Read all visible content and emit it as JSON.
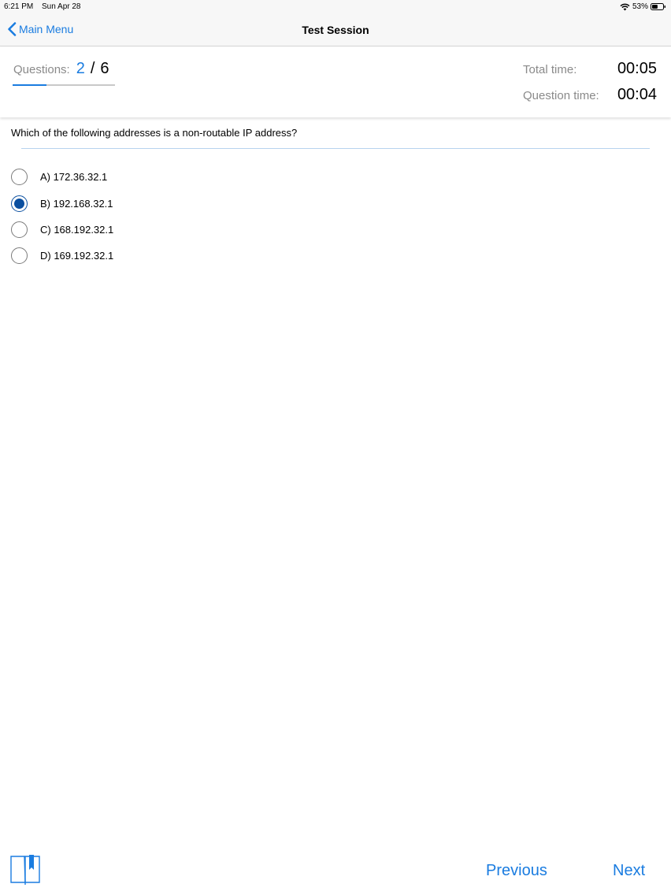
{
  "status_bar": {
    "time": "6:21 PM",
    "date": "Sun Apr 28",
    "battery": "53%",
    "battery_level": 0.53
  },
  "nav": {
    "back_label": "Main Menu",
    "title": "Test Session"
  },
  "header": {
    "questions_label": "Questions:",
    "current": "2",
    "separator": "/",
    "total": "6",
    "progress": 0.333,
    "total_time_label": "Total time:",
    "total_time": "00:05",
    "question_time_label": "Question time:",
    "question_time": "00:04"
  },
  "question": {
    "text": "Which of the following addresses is a non-routable IP address?",
    "answers": [
      {
        "label": "A) 172.36.32.1",
        "selected": false
      },
      {
        "label": "B) 192.168.32.1",
        "selected": true
      },
      {
        "label": "C) 168.192.32.1",
        "selected": false
      },
      {
        "label": "D) 169.192.32.1",
        "selected": false
      }
    ]
  },
  "footer": {
    "previous_label": "Previous",
    "next_label": "Next",
    "bookmark_icon": "bookmark-book-icon"
  },
  "colors": {
    "accent": "#1a7ce0",
    "selected_radio": "#0a4fa0",
    "secondary_text": "#8a8a8a"
  }
}
